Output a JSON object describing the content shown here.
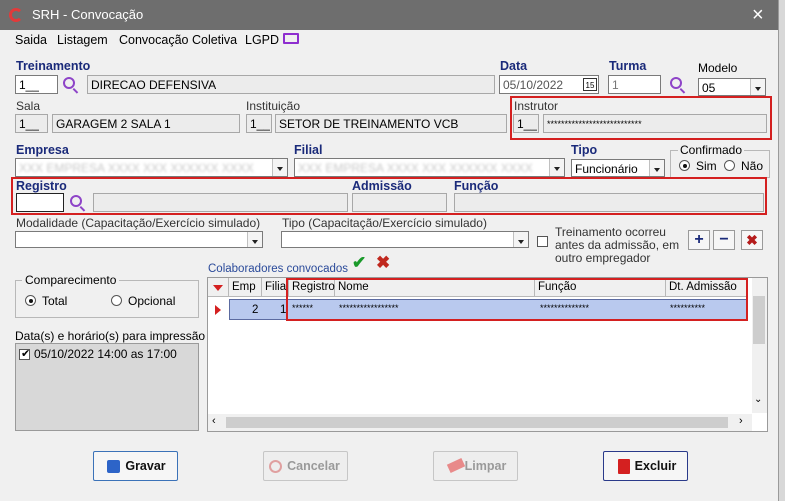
{
  "window": {
    "title": "SRH - Convocação",
    "close_icon": "×"
  },
  "menu": [
    "Saida",
    "Listagem",
    "Convocação Coletiva",
    "LGPD"
  ],
  "treinamento": {
    "label": "Treinamento",
    "code": "1__",
    "name": "DIRECAO DEFENSIVA"
  },
  "data": {
    "label": "Data",
    "value": "05/10/2022",
    "calendar_icon": "15"
  },
  "turma": {
    "label": "Turma",
    "value": "1"
  },
  "modelo": {
    "label": "Modelo",
    "value": "05"
  },
  "sala": {
    "label": "Sala",
    "code": "1__",
    "name": "GARAGEM 2 SALA 1"
  },
  "instituicao": {
    "label": "Instituição",
    "code": "1__",
    "name": "SETOR DE TREINAMENTO VCB"
  },
  "instrutor": {
    "label": "Instrutor",
    "code": "1__",
    "name": "***************************"
  },
  "empresa": {
    "label": "Empresa",
    "value": "XXX EMPRESA XXXX XXX XXXXXX XXXX"
  },
  "filial": {
    "label": "Filial",
    "value": "XXX EMPRESA XXXX XXX XXXXXX XXXX"
  },
  "tipo": {
    "label": "Tipo",
    "value": "Funcionário"
  },
  "confirmado": {
    "label": "Confirmado",
    "sim": "Sim",
    "nao": "Não"
  },
  "registro": {
    "label": "Registro",
    "value": "",
    "name": ""
  },
  "admissao": {
    "label": "Admissão",
    "value": ""
  },
  "funcao": {
    "label": "Função",
    "value": ""
  },
  "modalidade": {
    "label": "Modalidade (Capacitação/Exercício simulado)",
    "value": ""
  },
  "tipo2": {
    "label": "Tipo (Capacitação/Exercício simulado)",
    "value": ""
  },
  "treinamento_check": {
    "label_line1": "Treinamento ocorreu",
    "label_line2": "antes da admissão, em",
    "label_line3": "outro empregador"
  },
  "toolbar": {
    "add": "+",
    "remove": "−",
    "delete": "✖"
  },
  "comparecimento": {
    "label": "Comparecimento",
    "total": "Total",
    "opcional": "Opcional"
  },
  "datas": {
    "label": "Data(s) e horário(s) para impressão",
    "items": [
      "05/10/2022 14:00 as 17:00"
    ]
  },
  "colaboradores": {
    "label": "Colaboradores convocados",
    "columns": [
      "Emp",
      "Filial",
      "Registro",
      "Nome",
      "Função",
      "Dt. Admissão"
    ],
    "rows": [
      {
        "emp": "2",
        "filial": "1",
        "registro": "******",
        "nome": "*****************",
        "funcao": "**************",
        "admissao": "**********"
      }
    ]
  },
  "buttons": {
    "gravar": "Gravar",
    "cancelar": "Cancelar",
    "limpar": "Limpar",
    "excluir": "Excluir"
  },
  "colors": {
    "accent_blue": "#1a2a7a",
    "highlight_red": "#d42020",
    "selected_row": "#b9c9ee"
  }
}
